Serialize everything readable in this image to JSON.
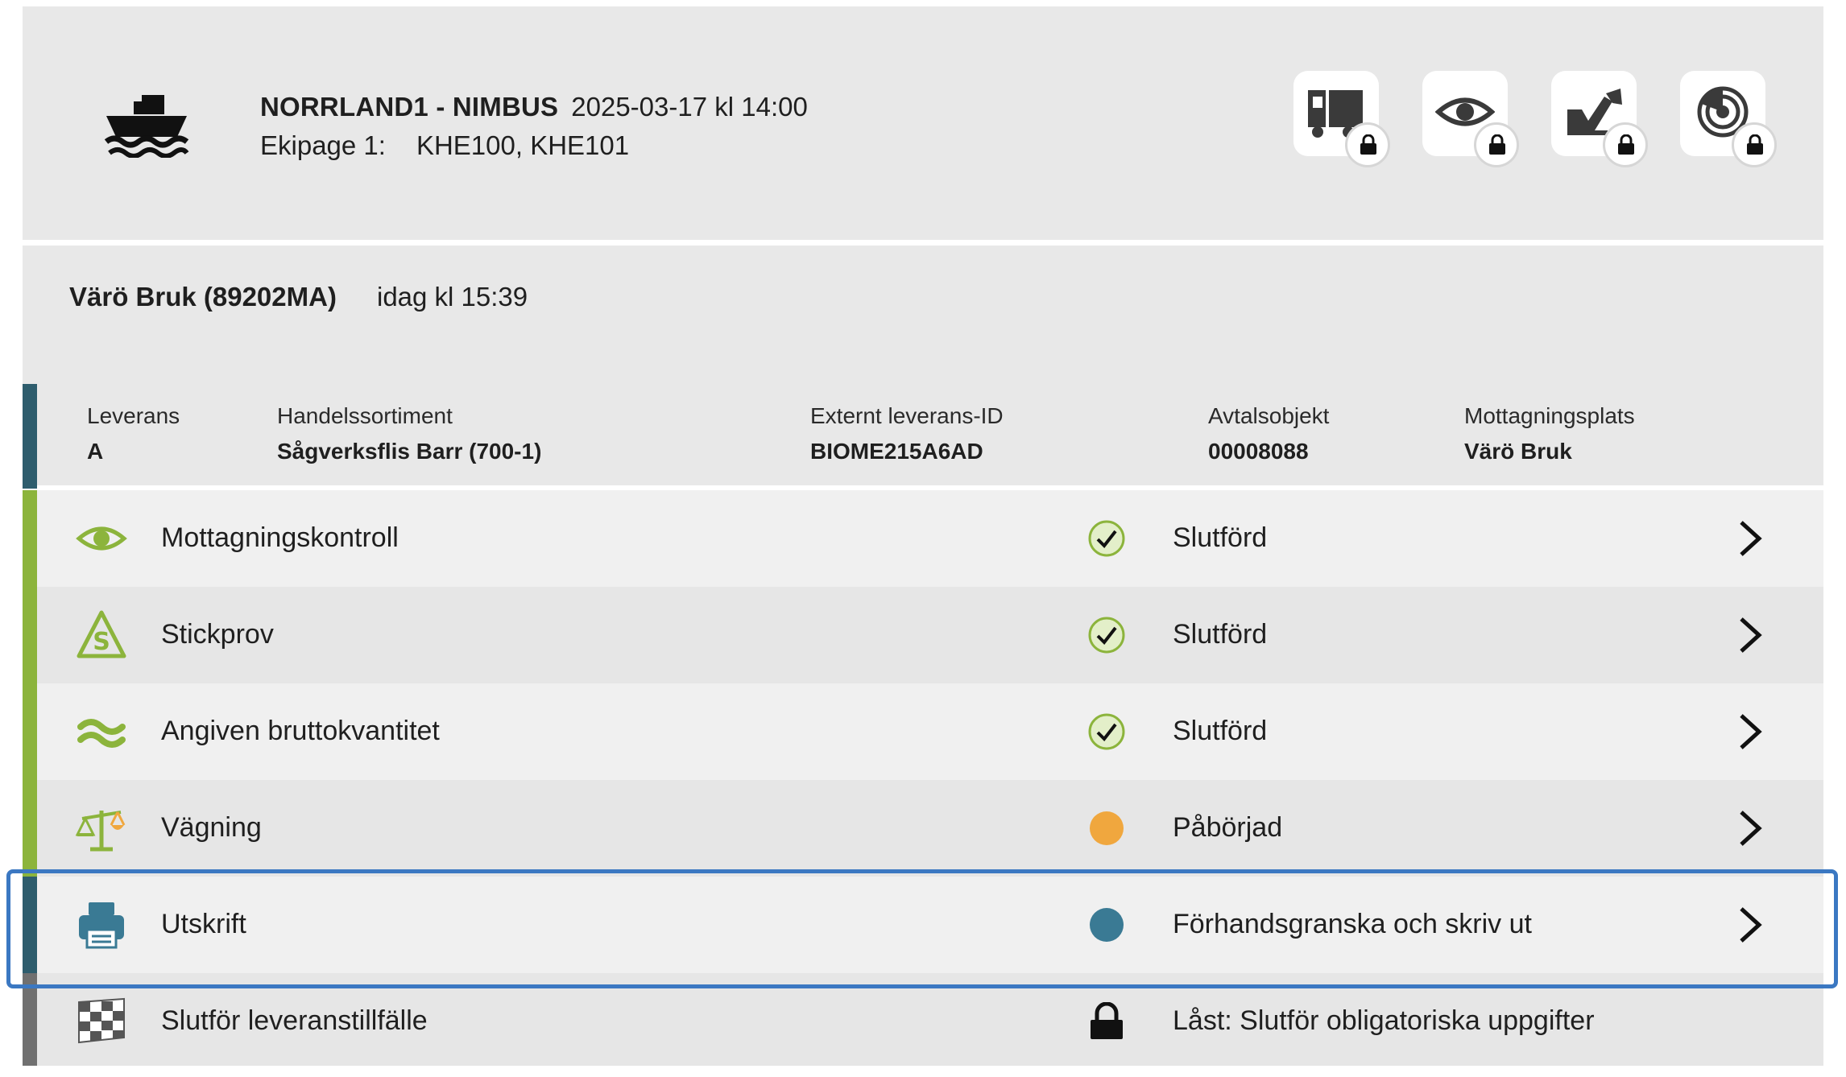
{
  "header": {
    "vessel_name": "NORRLAND1 - NIMBUS",
    "datetime": "2025-03-17 kl 14:00",
    "ekipage_label": "Ekipage 1:",
    "vehicles": "KHE100, KHE101",
    "tools": [
      {
        "icon": "truck-icon",
        "locked": true
      },
      {
        "icon": "eye-icon",
        "locked": true
      },
      {
        "icon": "excavator-icon",
        "locked": true
      },
      {
        "icon": "radar-icon",
        "locked": true
      }
    ]
  },
  "site": {
    "name": "Värö Bruk (89202MA)",
    "time": "idag kl 15:39"
  },
  "delivery": {
    "fields": [
      {
        "label": "Leverans",
        "value": "A"
      },
      {
        "label": "Handelssortiment",
        "value": "Sågverksflis Barr (700-1)"
      },
      {
        "label": "Externt leverans-ID",
        "value": "BIOME215A6AD"
      },
      {
        "label": "Avtalsobjekt",
        "value": "00008088"
      },
      {
        "label": "Mottagningsplats",
        "value": "Värö Bruk"
      }
    ]
  },
  "tasks": [
    {
      "name": "Mottagningskontroll",
      "icon": "eye-icon",
      "status": "Slutförd",
      "state": "done"
    },
    {
      "name": "Stickprov",
      "icon": "sample-icon",
      "status": "Slutförd",
      "state": "done"
    },
    {
      "name": "Angiven bruttokvantitet",
      "icon": "wave-icon",
      "status": "Slutförd",
      "state": "done"
    },
    {
      "name": "Vägning",
      "icon": "scale-icon",
      "status": "Påbörjad",
      "state": "started"
    },
    {
      "name": "Utskrift",
      "icon": "printer-icon",
      "status": "Förhandsgranska och skriv ut",
      "state": "ready"
    },
    {
      "name": "Slutför leveranstillfälle",
      "icon": "checkered-flag-icon",
      "status": "Låst: Slutför obligatoriska uppgifter",
      "state": "locked"
    }
  ],
  "colors": {
    "accent_green": "#8cb43c",
    "accent_blue": "#2e5d6d",
    "accent_gray": "#707070",
    "status_done_bg": "#e3efc9",
    "status_started": "#f0a73e",
    "status_ready": "#3a7a94",
    "highlight": "#3b78c2"
  }
}
